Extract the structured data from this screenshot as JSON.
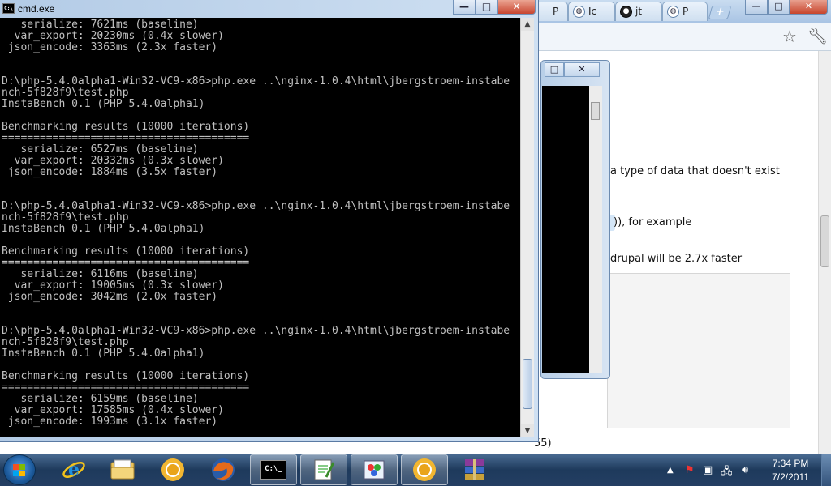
{
  "browser": {
    "tabs": [
      {
        "label": "P",
        "icon": "page-icon"
      },
      {
        "label": "Ic",
        "icon": "globe-icon"
      },
      {
        "label": "jt",
        "icon": "github-icon"
      },
      {
        "label": "P",
        "icon": "globe-icon"
      }
    ],
    "new_tab_label": "+",
    "controls": {
      "minimize": "—",
      "maximize": "□",
      "close": "✕"
    },
    "page_lines": [
      "a type of data that doesn't exist",
      ")), for example",
      "drupal will be 2.7x faster",
      "55)"
    ]
  },
  "small_window": {
    "controls": {
      "maximize": "□",
      "close": "✕"
    }
  },
  "cmd": {
    "title": "cmd.exe",
    "controls": {
      "minimize": "—",
      "maximize": "□",
      "close": "✕"
    },
    "scroll": {
      "up": "▲",
      "down": "▼"
    },
    "output": "   serialize: 7621ms (baseline)\n  var_export: 20230ms (0.4x slower)\n json_encode: 3363ms (2.3x faster)\n\n\nD:\\php-5.4.0alpha1-Win32-VC9-x86>php.exe ..\\nginx-1.0.4\\html\\jbergstroem-instabe\nnch-5f828f9\\test.php\nInstaBench 0.1 (PHP 5.4.0alpha1)\n\nBenchmarking results (10000 iterations)\n=======================================\n   serialize: 6527ms (baseline)\n  var_export: 20332ms (0.3x slower)\n json_encode: 1884ms (3.5x faster)\n\n\nD:\\php-5.4.0alpha1-Win32-VC9-x86>php.exe ..\\nginx-1.0.4\\html\\jbergstroem-instabe\nnch-5f828f9\\test.php\nInstaBench 0.1 (PHP 5.4.0alpha1)\n\nBenchmarking results (10000 iterations)\n=======================================\n   serialize: 6116ms (baseline)\n  var_export: 19005ms (0.3x slower)\n json_encode: 3042ms (2.0x faster)\n\n\nD:\\php-5.4.0alpha1-Win32-VC9-x86>php.exe ..\\nginx-1.0.4\\html\\jbergstroem-instabe\nnch-5f828f9\\test.php\nInstaBench 0.1 (PHP 5.4.0alpha1)\n\nBenchmarking results (10000 iterations)\n=======================================\n   serialize: 6159ms (baseline)\n  var_export: 17585ms (0.4x slower)\n json_encode: 1993ms (3.1x faster)"
  },
  "taskbar": {
    "apps": [
      {
        "name": "internet-explorer",
        "icon": "internet-explorer-icon"
      },
      {
        "name": "windows-explorer",
        "icon": "folder-icon"
      },
      {
        "name": "chrome",
        "icon": "chrome-icon"
      },
      {
        "name": "firefox",
        "icon": "firefox-icon"
      },
      {
        "name": "cmd",
        "icon": "cmd-icon",
        "label": "C:\\_"
      },
      {
        "name": "notepad-plus-plus",
        "icon": "notepad-plus-plus-icon"
      },
      {
        "name": "paint",
        "icon": "paint-icon"
      },
      {
        "name": "chrome-2",
        "icon": "chrome-icon"
      },
      {
        "name": "winrar",
        "icon": "winrar-icon"
      }
    ],
    "tray": {
      "show_hidden": "▲",
      "icons": [
        "security-flag-icon",
        "network-device-icon",
        "network-icon",
        "volume-icon"
      ]
    },
    "clock": {
      "time": "7:34 PM",
      "date": "7/2/2011"
    }
  },
  "colors": {
    "console_bg": "#000000",
    "console_text": "#c0c0c0",
    "taskbar": "#1e3a5c",
    "window_frame": "#b3cbe6"
  }
}
